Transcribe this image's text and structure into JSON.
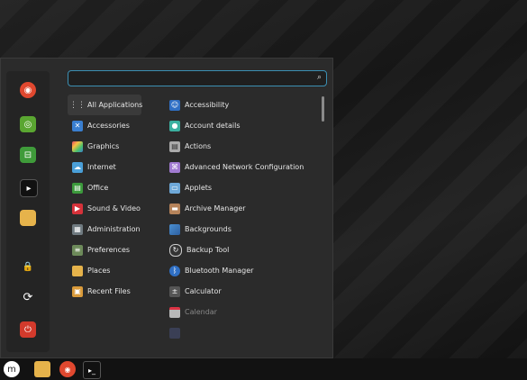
{
  "search": {
    "placeholder": ""
  },
  "categories": [
    {
      "label": "All Applications",
      "icon": "grid-icon"
    },
    {
      "label": "Accessories",
      "icon": "accessories-icon"
    },
    {
      "label": "Graphics",
      "icon": "graphics-icon"
    },
    {
      "label": "Internet",
      "icon": "internet-icon"
    },
    {
      "label": "Office",
      "icon": "office-icon"
    },
    {
      "label": "Sound & Video",
      "icon": "sound-video-icon"
    },
    {
      "label": "Administration",
      "icon": "administration-icon"
    },
    {
      "label": "Preferences",
      "icon": "preferences-icon"
    },
    {
      "label": "Places",
      "icon": "folder-icon"
    },
    {
      "label": "Recent Files",
      "icon": "recent-files-icon"
    }
  ],
  "apps": [
    {
      "label": "Accessibility",
      "icon": "accessibility-icon"
    },
    {
      "label": "Account details",
      "icon": "account-icon"
    },
    {
      "label": "Actions",
      "icon": "actions-icon"
    },
    {
      "label": "Advanced Network Configuration",
      "icon": "network-icon"
    },
    {
      "label": "Applets",
      "icon": "applets-icon"
    },
    {
      "label": "Archive Manager",
      "icon": "archive-icon"
    },
    {
      "label": "Backgrounds",
      "icon": "backgrounds-icon"
    },
    {
      "label": "Backup Tool",
      "icon": "backup-icon"
    },
    {
      "label": "Bluetooth Manager",
      "icon": "bluetooth-icon"
    },
    {
      "label": "Calculator",
      "icon": "calculator-icon"
    },
    {
      "label": "Calendar",
      "icon": "calendar-icon"
    }
  ],
  "favorites": [
    "firefox-icon",
    "network-globe-icon",
    "settings-toggle-icon",
    "terminal-icon",
    "folder-icon",
    "lock-icon",
    "logout-icon",
    "power-icon"
  ],
  "taskbar": [
    "mint-menu-icon",
    "folder-icon",
    "firefox-icon",
    "terminal-icon"
  ],
  "colors": {
    "accent": "#3b8fb3",
    "menu_bg": "#2b2b2b",
    "power": "#d33a2c"
  }
}
